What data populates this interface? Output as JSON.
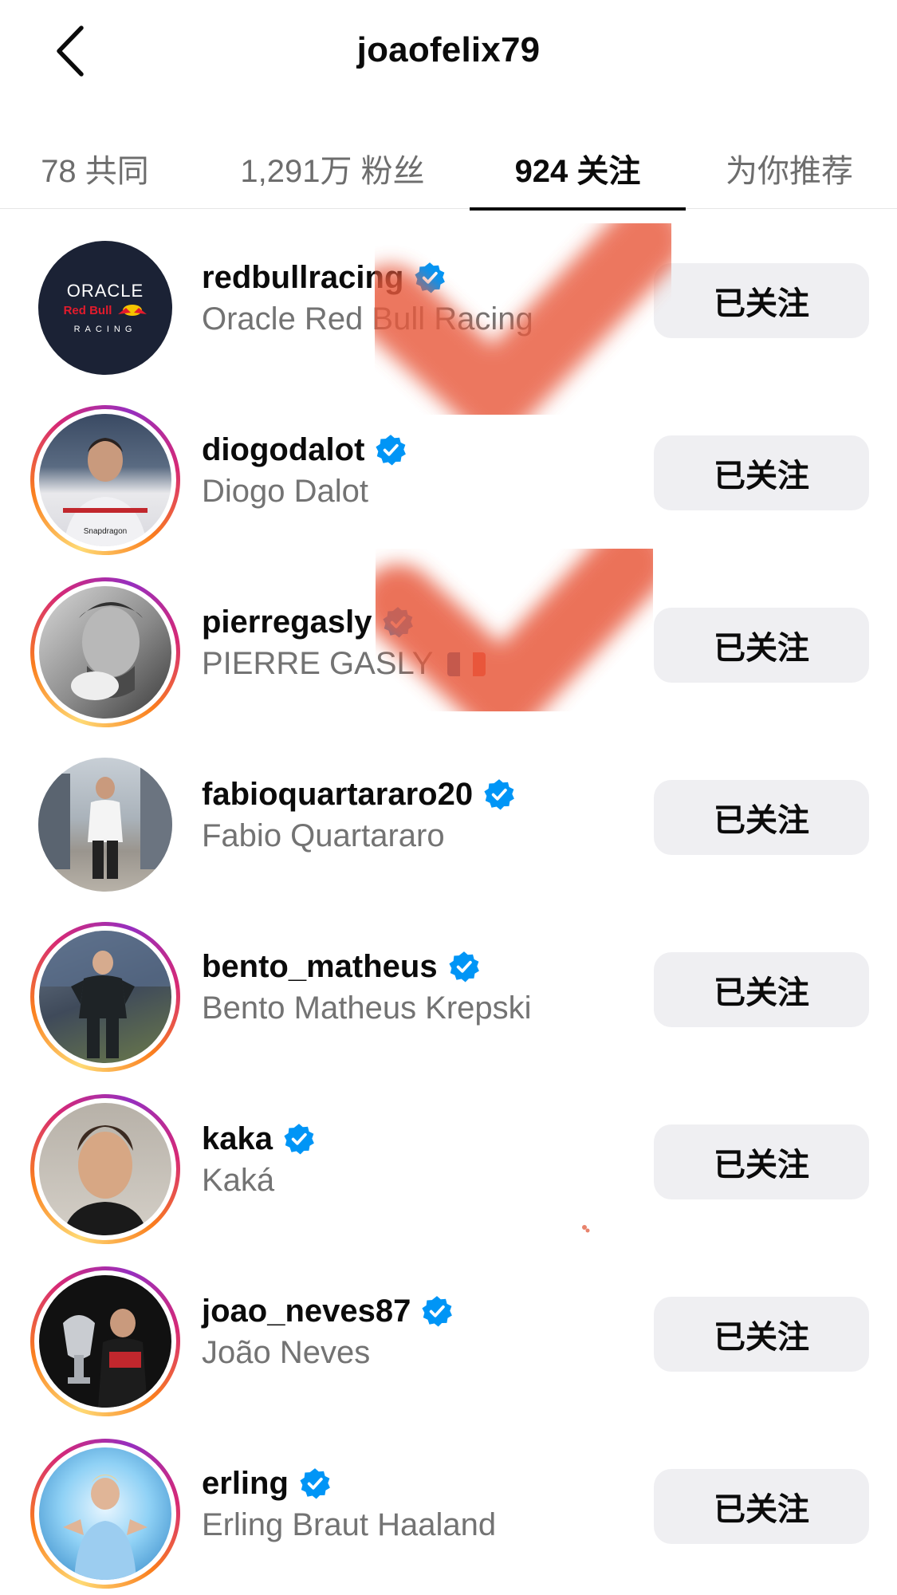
{
  "header": {
    "title": "joaofelix79"
  },
  "tabs": [
    {
      "label": "78 共同",
      "active": false
    },
    {
      "label": "1,291万 粉丝",
      "active": false
    },
    {
      "label": "924 关注",
      "active": true
    },
    {
      "label": "为你推荐",
      "active": false
    }
  ],
  "follow_button_label": "已关注",
  "accounts": [
    {
      "username": "redbullracing",
      "full_name": "Oracle Red Bull Racing",
      "verified": true,
      "story_ring": false,
      "avatar_text": [
        "ORACLE",
        "Red Bull",
        "RACING"
      ]
    },
    {
      "username": "diogodalot",
      "full_name": "Diogo Dalot",
      "verified": true,
      "story_ring": true,
      "avatar_text": [
        "Snapdragon"
      ]
    },
    {
      "username": "pierregasly",
      "full_name": "PIERRE GASLY",
      "verified": true,
      "story_ring": true,
      "flag": "france"
    },
    {
      "username": "fabioquartararo20",
      "full_name": "Fabio Quartararo",
      "verified": true,
      "story_ring": false
    },
    {
      "username": "bento_matheus",
      "full_name": "Bento Matheus Krepski",
      "verified": true,
      "story_ring": true
    },
    {
      "username": "kaka",
      "full_name": "Kaká",
      "verified": true,
      "story_ring": true
    },
    {
      "username": "joao_neves87",
      "full_name": "João Neves",
      "verified": true,
      "story_ring": true
    },
    {
      "username": "erling",
      "full_name": "Erling Braut Haaland",
      "verified": true,
      "story_ring": true
    }
  ],
  "colors": {
    "verified": "#0095f6",
    "button_bg": "#efeff2",
    "secondary_text": "#737373",
    "redaction": "#e85a3e"
  }
}
